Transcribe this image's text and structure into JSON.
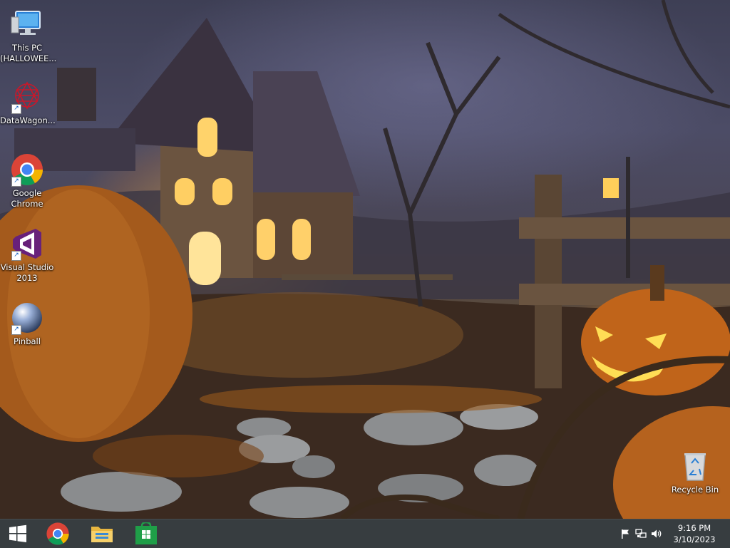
{
  "desktop": {
    "icons": [
      {
        "label": "This PC\n(HALLOWEE...",
        "icon": "this-pc-icon"
      },
      {
        "label": "DataWagon...",
        "icon": "datawagon-icon"
      },
      {
        "label": "Google\nChrome",
        "icon": "chrome-icon"
      },
      {
        "label": "Visual Studio\n2013",
        "icon": "visual-studio-icon"
      },
      {
        "label": "Pinball",
        "icon": "pinball-icon"
      },
      {
        "label": "Recycle Bin",
        "icon": "recycle-bin-icon"
      }
    ]
  },
  "taskbar": {
    "start": {
      "icon": "windows-logo-icon"
    },
    "pinned": [
      {
        "name": "Google Chrome",
        "icon": "chrome-icon"
      },
      {
        "name": "File Explorer",
        "icon": "file-explorer-icon"
      },
      {
        "name": "Store",
        "icon": "store-icon"
      }
    ],
    "tray": {
      "icons": [
        "flag-icon",
        "network-icon",
        "volume-icon"
      ],
      "time": "9:16 PM",
      "date": "3/10/2023"
    }
  },
  "colors": {
    "taskbar": "#262c30",
    "accent_green": "#1f9e48",
    "vs_purple": "#68217a"
  }
}
